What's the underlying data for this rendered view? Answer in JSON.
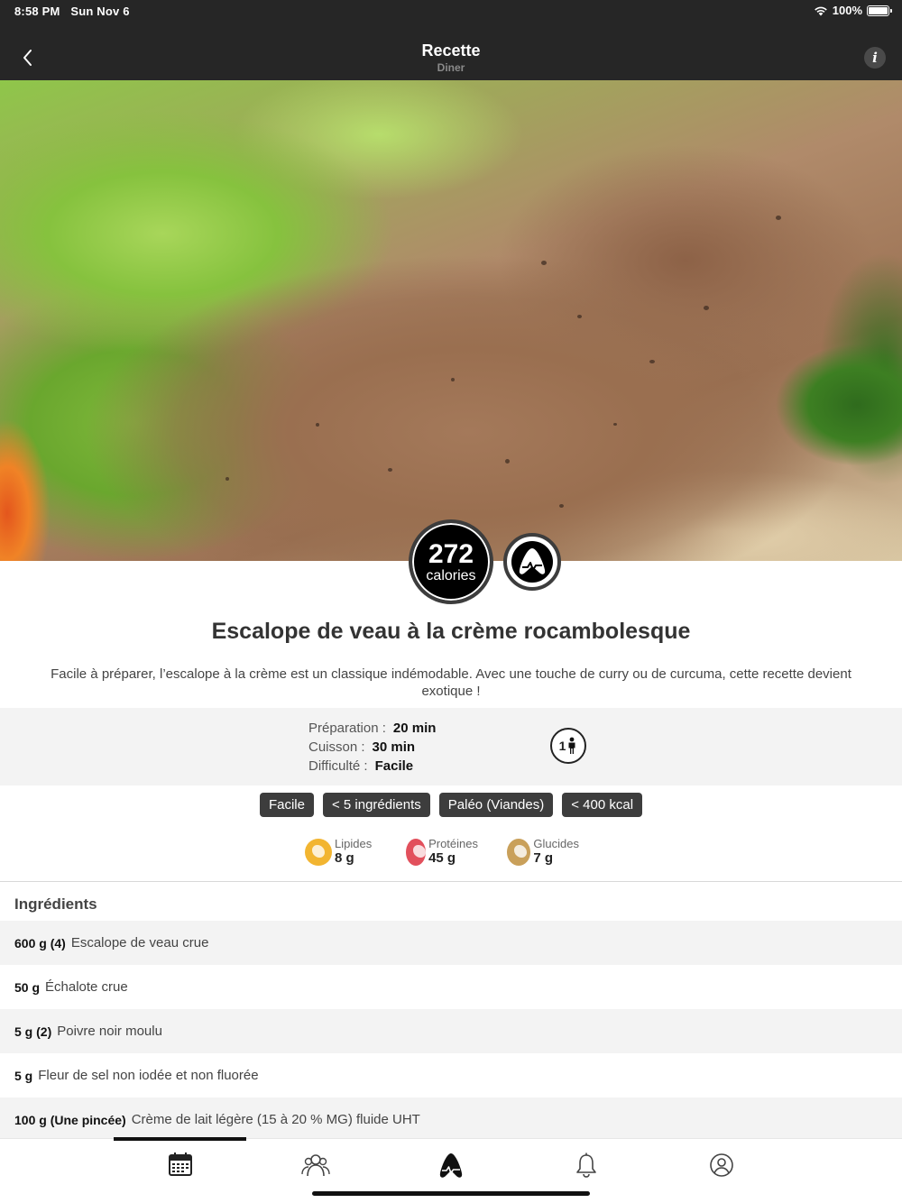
{
  "status": {
    "time": "8:58 PM",
    "date": "Sun Nov 6",
    "battery": "100%"
  },
  "nav": {
    "title": "Recette",
    "subtitle": "Diner",
    "info_label": "i"
  },
  "hero": {
    "calories_value": "272",
    "calories_unit": "calories"
  },
  "recipe": {
    "title": "Escalope de veau à la crème rocambolesque",
    "description": "Facile à préparer, l’escalope à la crème est un classique indémodable. Avec une touche de curry ou de curcuma, cette recette devient exotique !"
  },
  "info": {
    "prep_label": "Préparation :",
    "prep_value": "20 min",
    "cook_label": "Cuisson :",
    "cook_value": "30 min",
    "difficulty_label": "Difficulté :",
    "difficulty_value": "Facile",
    "people": "1"
  },
  "tags": [
    "Facile",
    "< 5 ingrédients",
    "Paléo (Viandes)",
    "< 400 kcal"
  ],
  "macros": [
    {
      "label": "Lipides",
      "value": "8 g",
      "color": "#f2b531"
    },
    {
      "label": "Protéines",
      "value": "45 g",
      "color": "#e2505c"
    },
    {
      "label": "Glucides",
      "value": "7 g",
      "color": "#c9a05a"
    }
  ],
  "ingredients_title": "Ingrédients",
  "ingredients": [
    {
      "qty": "600 g (4)",
      "name": "Escalope de veau crue"
    },
    {
      "qty": "50 g",
      "name": "Échalote crue"
    },
    {
      "qty": "5 g (2)",
      "name": "Poivre noir moulu"
    },
    {
      "qty": "5 g",
      "name": "Fleur de sel non iodée et non fluorée"
    },
    {
      "qty": "100 g (Une pincée)",
      "name": "Crème de lait légère (15 à 20 % MG) fluide UHT"
    }
  ],
  "tabbar": {
    "active": "calendar",
    "items": [
      "calendar-icon",
      "community-icon",
      "app-logo-icon",
      "bell-icon",
      "profile-icon"
    ]
  }
}
